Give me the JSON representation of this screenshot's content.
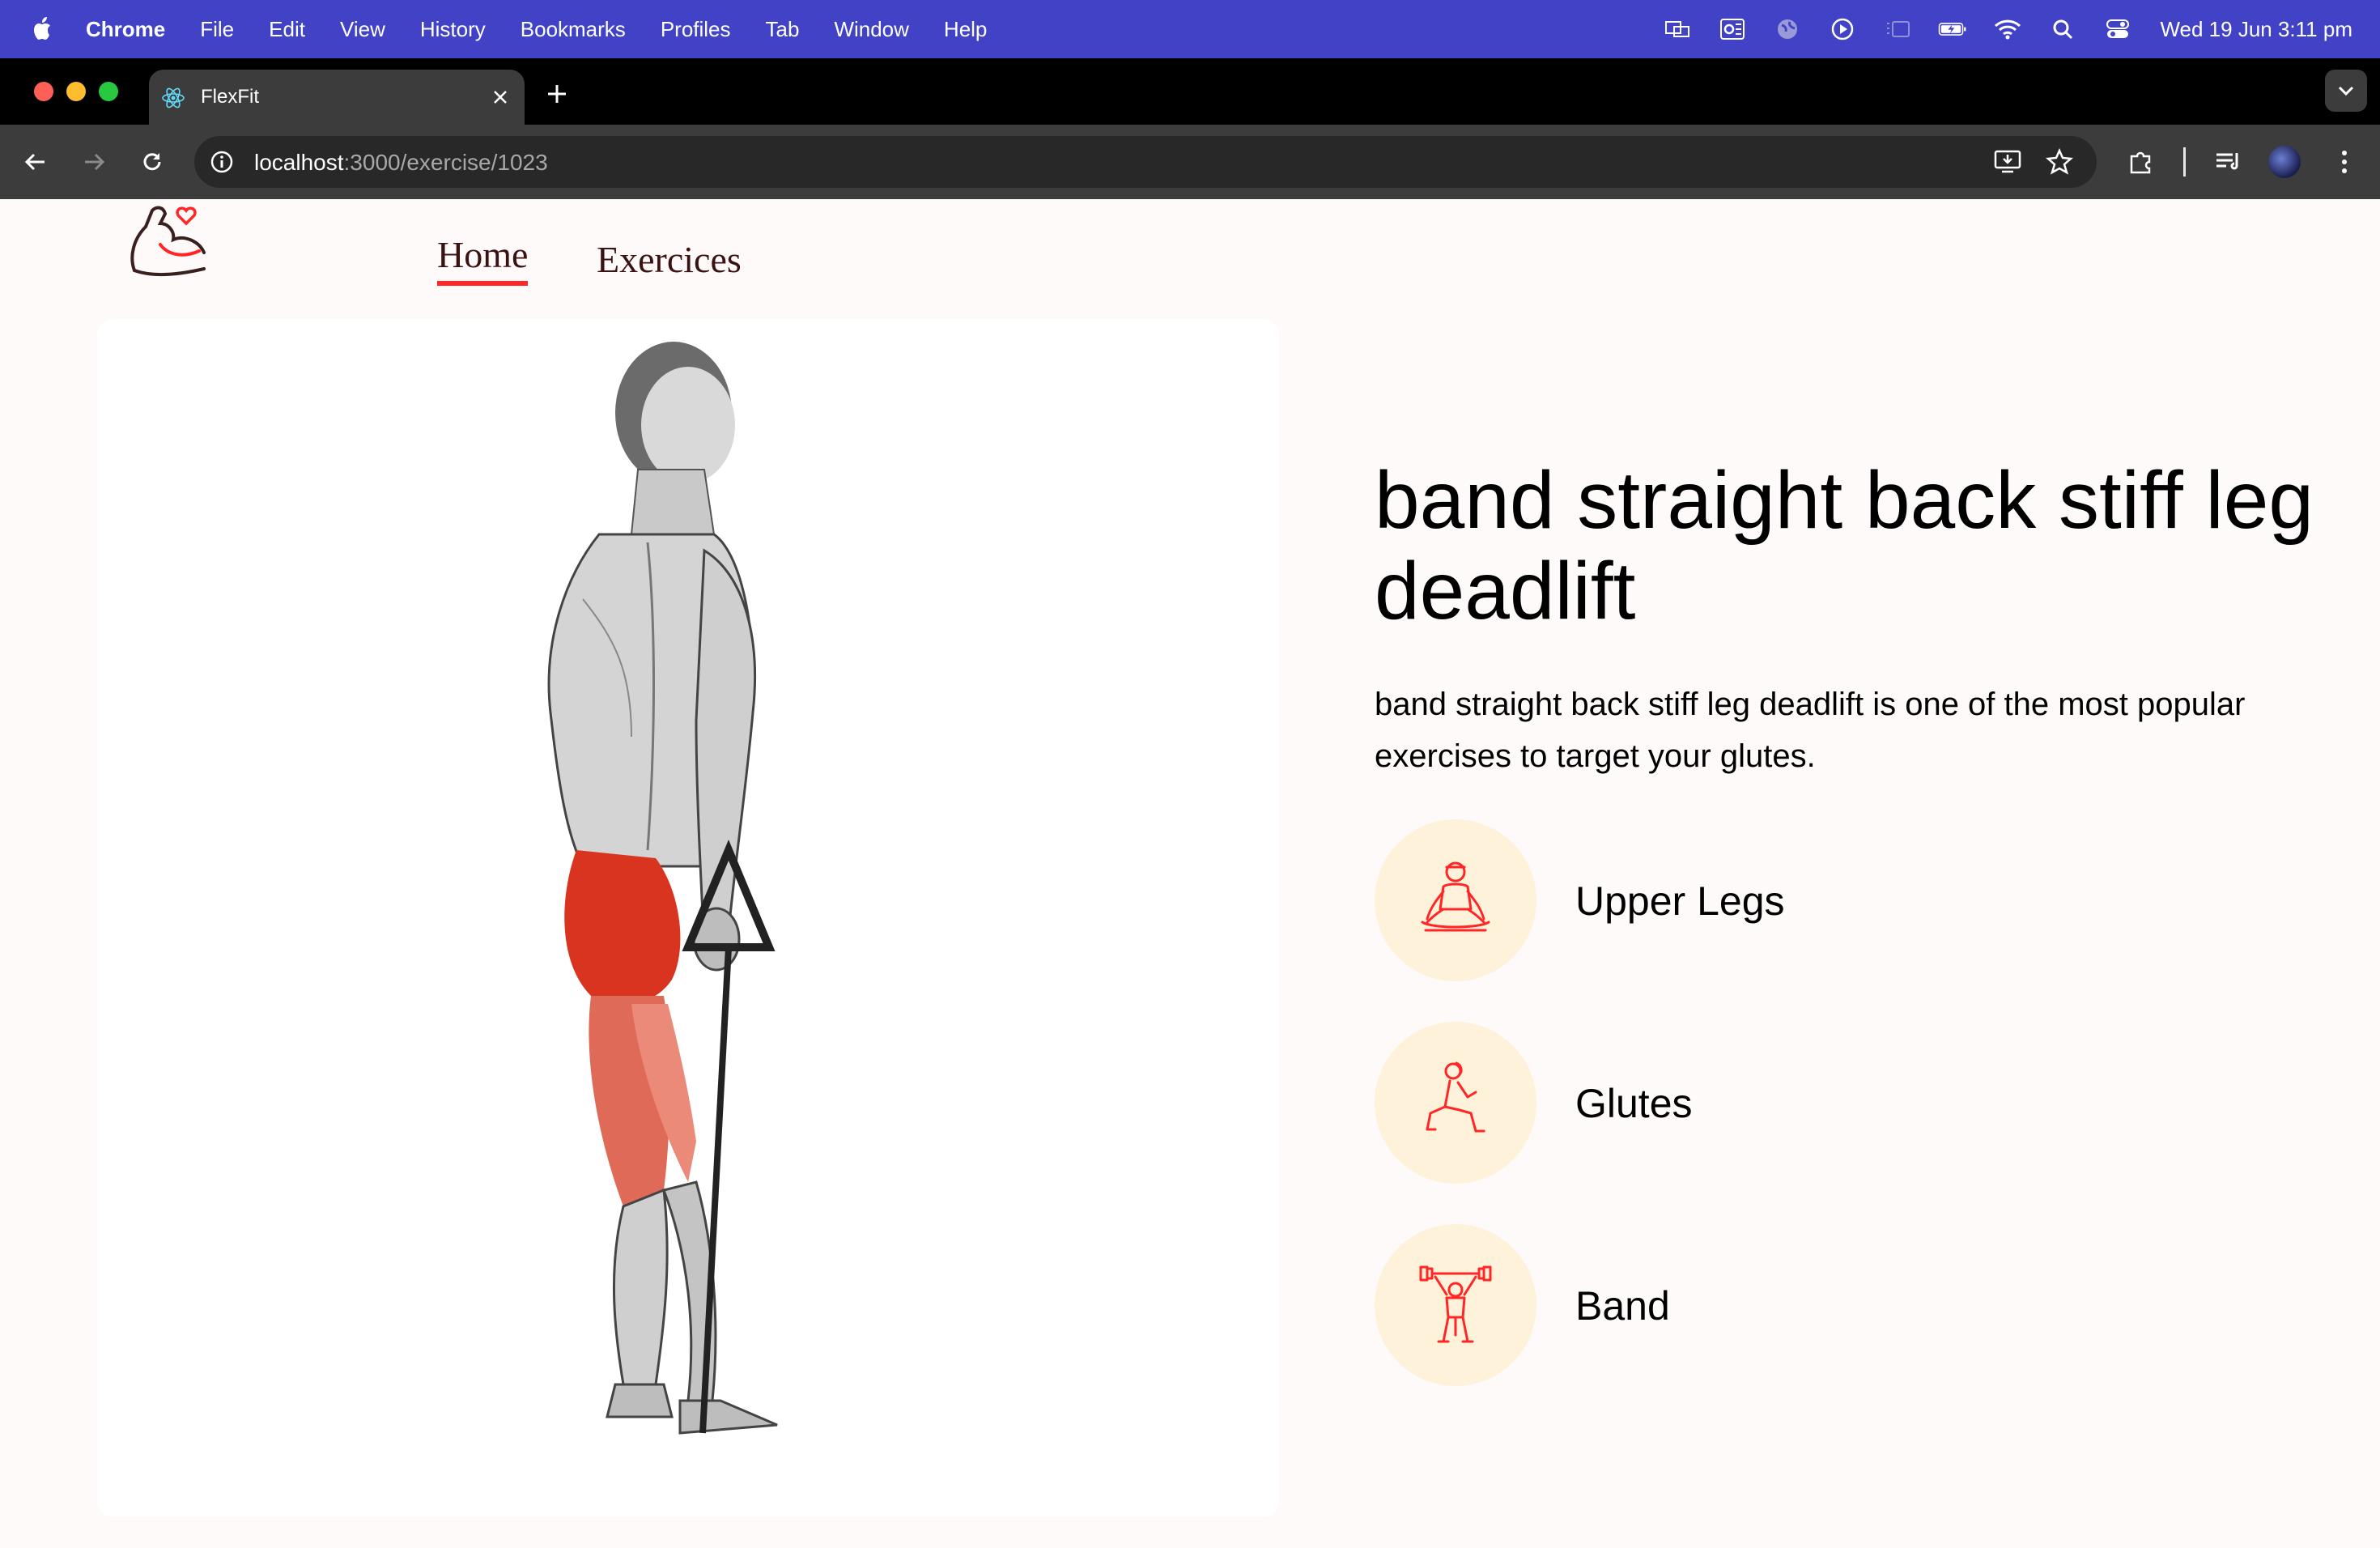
{
  "menubar": {
    "app_name": "Chrome",
    "items": [
      "File",
      "Edit",
      "View",
      "History",
      "Bookmarks",
      "Profiles",
      "Tab",
      "Window",
      "Help"
    ],
    "clock": "Wed 19 Jun  3:11 pm"
  },
  "browser": {
    "tab_title": "FlexFit",
    "url_host": "localhost",
    "url_path": ":3000/exercise/1023"
  },
  "nav": {
    "home": "Home",
    "exercises": "Exercices"
  },
  "exercise": {
    "name": "band straight back stiff leg deadlift",
    "description": "band straight back stiff leg deadlift is one of the most popular exercises to target your glutes.",
    "details": [
      {
        "label": "Upper Legs",
        "icon": "body-part-icon"
      },
      {
        "label": "Glutes",
        "icon": "target-muscle-icon"
      },
      {
        "label": "Band",
        "icon": "equipment-icon"
      }
    ]
  },
  "colors": {
    "menubar": "#4142c6",
    "accent": "#ff2625",
    "chip_bg": "#fff2db",
    "page_bg": "#fffafa"
  }
}
